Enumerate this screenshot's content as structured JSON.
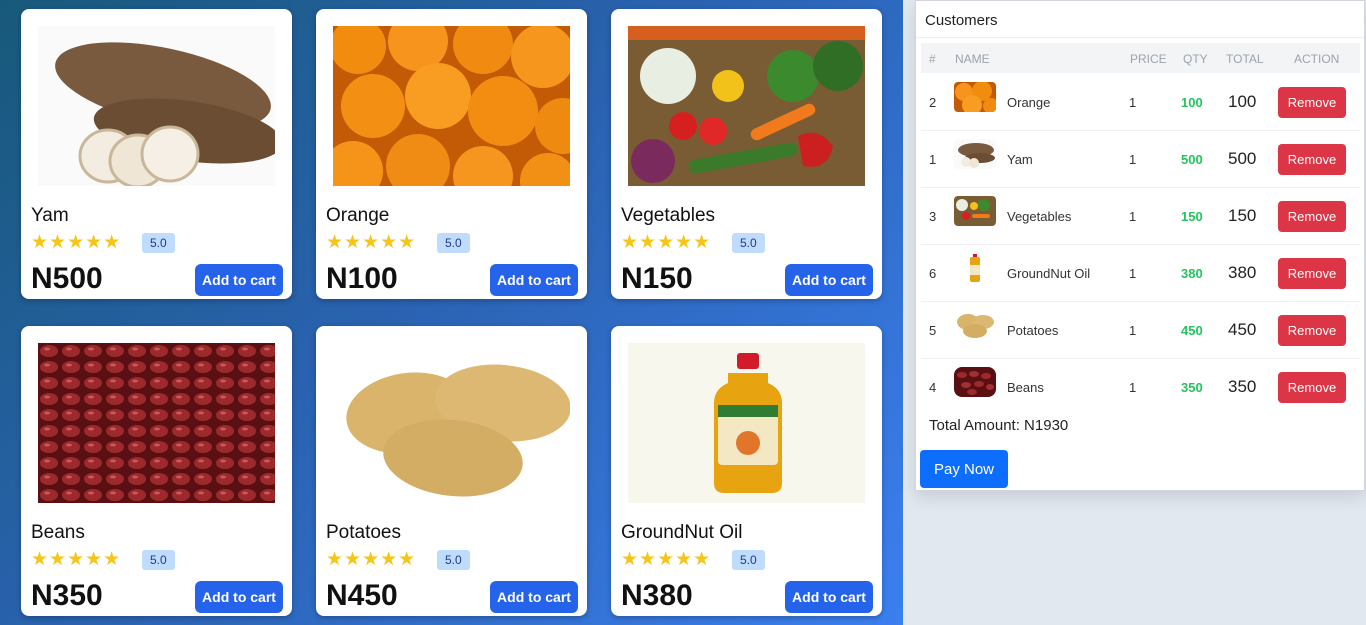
{
  "products": [
    {
      "name": "Yam",
      "stars": "★★★★★",
      "rating": "5.0",
      "price": "N500",
      "button": "Add to cart",
      "image": "yam-image"
    },
    {
      "name": "Orange",
      "stars": "★★★★★",
      "rating": "5.0",
      "price": "N100",
      "button": "Add to cart",
      "image": "orange-image"
    },
    {
      "name": "Vegetables",
      "stars": "★★★★★",
      "rating": "5.0",
      "price": "N150",
      "button": "Add to cart",
      "image": "vegetables-image"
    },
    {
      "name": "Beans",
      "stars": "★★★★★",
      "rating": "5.0",
      "price": "N350",
      "button": "Add to cart",
      "image": "beans-image"
    },
    {
      "name": "Potatoes",
      "stars": "★★★★★",
      "rating": "5.0",
      "price": "N450",
      "button": "Add to cart",
      "image": "potatoes-image"
    },
    {
      "name": "GroundNut Oil",
      "stars": "★★★★★",
      "rating": "5.0",
      "price": "N380",
      "button": "Add to cart",
      "image": "groundnut-oil-image"
    }
  ],
  "cart": {
    "title": "Customers",
    "headers": {
      "index": "#",
      "name": "NAME",
      "price": "PRICE",
      "qty": "QTY",
      "total": "TOTAL",
      "action": "ACTION"
    },
    "rows": [
      {
        "index": "2",
        "name": "Orange",
        "price": "1",
        "qty": "100",
        "total": "100",
        "action": "Remove"
      },
      {
        "index": "1",
        "name": "Yam",
        "price": "1",
        "qty": "500",
        "total": "500",
        "action": "Remove"
      },
      {
        "index": "3",
        "name": "Vegetables",
        "price": "1",
        "qty": "150",
        "total": "150",
        "action": "Remove"
      },
      {
        "index": "6",
        "name": "GroundNut Oil",
        "price": "1",
        "qty": "380",
        "total": "380",
        "action": "Remove"
      },
      {
        "index": "5",
        "name": "Potatoes",
        "price": "1",
        "qty": "450",
        "total": "450",
        "action": "Remove"
      },
      {
        "index": "4",
        "name": "Beans",
        "price": "1",
        "qty": "350",
        "total": "350",
        "action": "Remove"
      }
    ],
    "total_amount": "Total Amount: N1930",
    "pay_label": "Pay Now"
  },
  "colors": {
    "primary_button": "#2563eb",
    "remove_button": "#dc3545",
    "pay_button": "#0d6efd",
    "qty_green": "#22c55e",
    "star": "#f5c518",
    "rating_badge": "#bfdbfe"
  }
}
